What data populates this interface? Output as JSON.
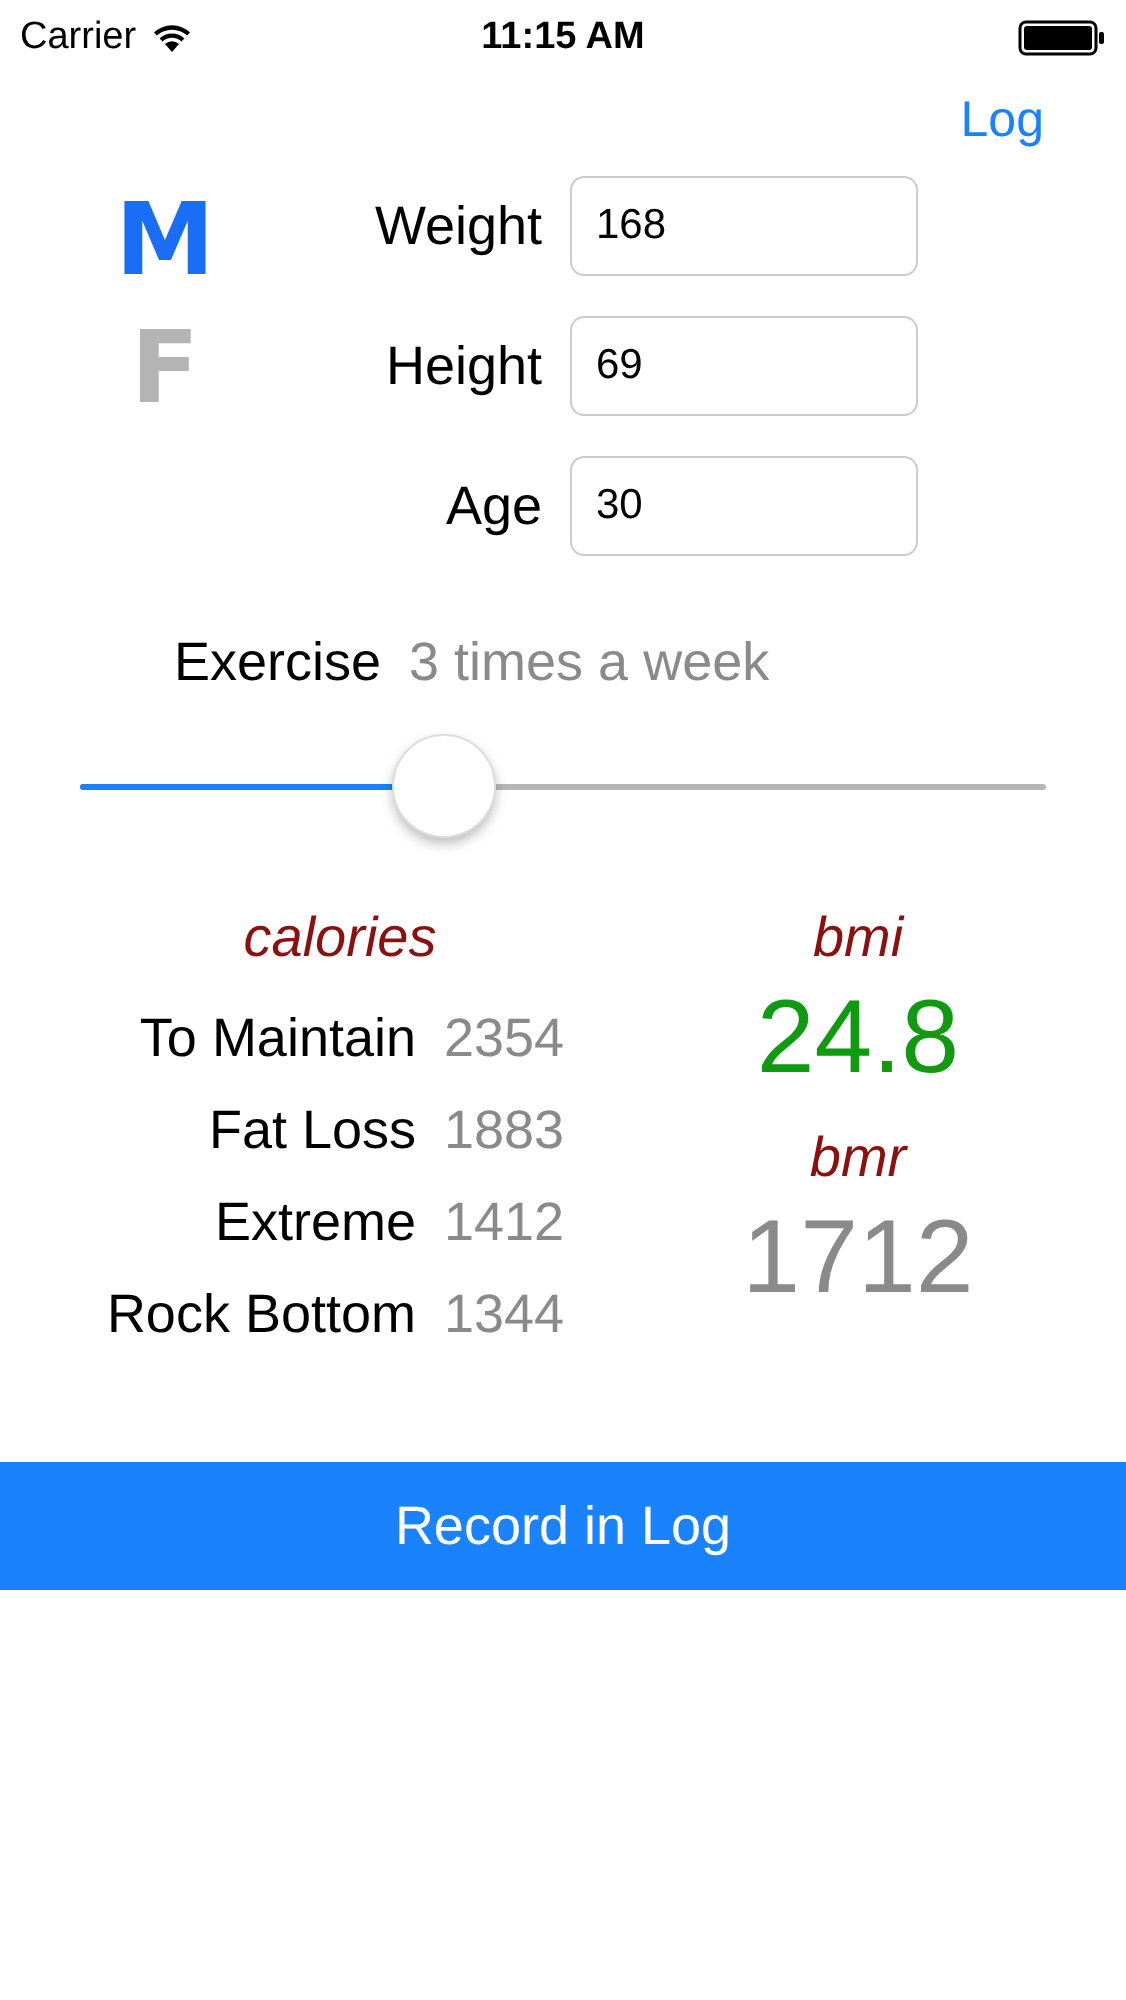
{
  "status_bar": {
    "carrier": "Carrier",
    "time": "11:15 AM"
  },
  "nav": {
    "log_link": "Log"
  },
  "genders": [
    {
      "label": "M",
      "selected": true
    },
    {
      "label": "F",
      "selected": false
    }
  ],
  "fields": [
    {
      "label": "Weight",
      "value": "168"
    },
    {
      "label": "Height",
      "value": "69"
    },
    {
      "label": "Age",
      "value": "30"
    }
  ],
  "exercise": {
    "label": "Exercise",
    "value": "3 times a week",
    "level": 0.377
  },
  "calories": {
    "title": "calories",
    "rows": [
      {
        "label": "To Maintain",
        "value": "2354"
      },
      {
        "label": "Fat Loss",
        "value": "1883"
      },
      {
        "label": "Extreme",
        "value": "1412"
      },
      {
        "label": "Rock Bottom",
        "value": "1344"
      }
    ]
  },
  "bmi": {
    "title": "bmi",
    "value": "24.8"
  },
  "bmr": {
    "title": "bmr",
    "value": "1712"
  },
  "record_button": "Record in Log"
}
